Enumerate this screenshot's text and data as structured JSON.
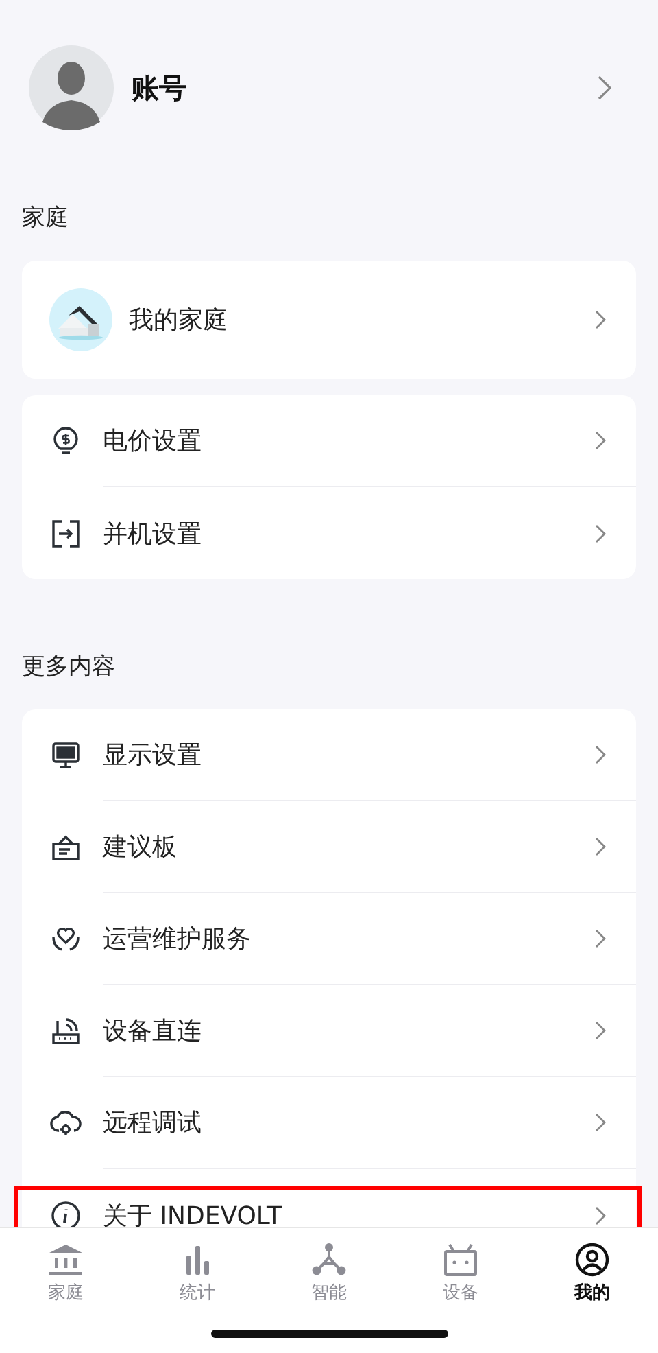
{
  "account": {
    "name": "账号"
  },
  "sections": [
    {
      "title": "家庭",
      "cards": [
        [
          {
            "kind": "home-photo",
            "label": "我的家庭",
            "highlighted": false
          }
        ],
        [
          {
            "kind": "bulb",
            "label": "电价设置",
            "highlighted": false
          },
          {
            "kind": "parallel",
            "label": "并机设置",
            "highlighted": false
          }
        ]
      ]
    },
    {
      "title": "更多内容",
      "cards": [
        [
          {
            "kind": "monitor",
            "label": "显示设置",
            "highlighted": false
          },
          {
            "kind": "board",
            "label": "建议板",
            "highlighted": false
          },
          {
            "kind": "heart-hand",
            "label": "运营维护服务",
            "highlighted": false
          },
          {
            "kind": "router",
            "label": "设备直连",
            "highlighted": false
          },
          {
            "kind": "cloud-gear",
            "label": "远程调试",
            "highlighted": false
          },
          {
            "kind": "info",
            "label": "关于 INDEVOLT",
            "highlighted": true
          }
        ]
      ]
    }
  ],
  "tabs": [
    {
      "kind": "home",
      "label": "家庭",
      "selected": false
    },
    {
      "kind": "stats",
      "label": "统计",
      "selected": false
    },
    {
      "kind": "smart",
      "label": "智能",
      "selected": false
    },
    {
      "kind": "device",
      "label": "设备",
      "selected": false
    },
    {
      "kind": "me",
      "label": "我的",
      "selected": true
    }
  ]
}
